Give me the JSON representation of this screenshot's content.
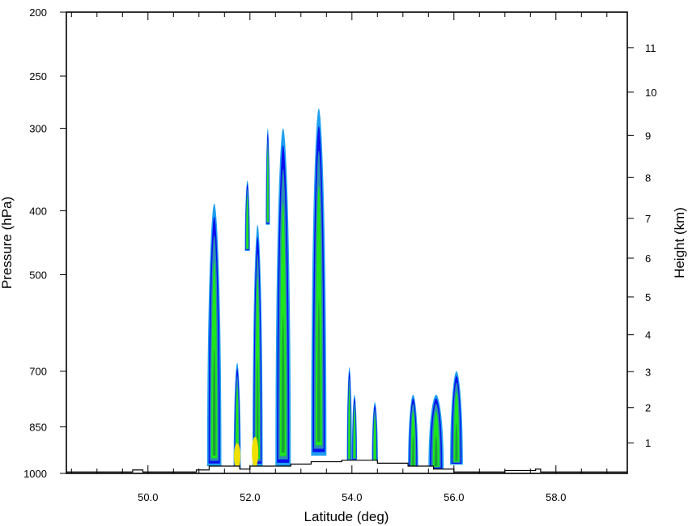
{
  "chart_data": {
    "type": "contour",
    "xlabel": "Latitude (deg)",
    "ylabel_left": "Pressure (hPa)",
    "ylabel_right": "Height (km)",
    "xlim": [
      48.4,
      59.4
    ],
    "x_ticks": [
      "50.0",
      "52.0",
      "54.0",
      "56.0",
      "58.0"
    ],
    "x_tick_values": [
      50,
      52,
      54,
      56,
      58
    ],
    "x_minor_step": 0.5,
    "ylim_pressure": [
      1000,
      200
    ],
    "y_scale": "log",
    "pressure_ticks": [
      "200",
      "250",
      "300",
      "400",
      "500",
      "700",
      "850",
      "1000"
    ],
    "pressure_tick_values": [
      200,
      250,
      300,
      400,
      500,
      700,
      850,
      1000
    ],
    "height_ticks": [
      "1",
      "2",
      "3",
      "4",
      "5",
      "6",
      "7",
      "8",
      "9",
      "10",
      "11"
    ],
    "height_tick_values": [
      1,
      2,
      3,
      4,
      5,
      6,
      7,
      8,
      9,
      10,
      11
    ],
    "colors": {
      "light_blue": "#1f9ff0",
      "blue": "#0a10f0",
      "teal": "#2a8fb0",
      "green": "#1ee61e",
      "dark_green": "#1aa23a",
      "yellow": "#f0e000",
      "outline": "#000000"
    },
    "columns": [
      {
        "lat": 51.3,
        "width": 0.28,
        "top_hPa": 390,
        "bottom_hPa": 975
      },
      {
        "lat": 51.75,
        "width": 0.14,
        "top_hPa": 680,
        "bottom_hPa": 985
      },
      {
        "lat": 51.95,
        "width": 0.1,
        "top_hPa": 360,
        "bottom_hPa": 460
      },
      {
        "lat": 52.15,
        "width": 0.2,
        "top_hPa": 420,
        "bottom_hPa": 975
      },
      {
        "lat": 52.35,
        "width": 0.08,
        "top_hPa": 300,
        "bottom_hPa": 420
      },
      {
        "lat": 52.65,
        "width": 0.3,
        "top_hPa": 300,
        "bottom_hPa": 975
      },
      {
        "lat": 53.35,
        "width": 0.3,
        "top_hPa": 280,
        "bottom_hPa": 940
      },
      {
        "lat": 53.95,
        "width": 0.1,
        "top_hPa": 690,
        "bottom_hPa": 960
      },
      {
        "lat": 54.05,
        "width": 0.1,
        "top_hPa": 760,
        "bottom_hPa": 955
      },
      {
        "lat": 54.45,
        "width": 0.12,
        "top_hPa": 780,
        "bottom_hPa": 970
      },
      {
        "lat": 55.2,
        "width": 0.2,
        "top_hPa": 760,
        "bottom_hPa": 985
      },
      {
        "lat": 55.65,
        "width": 0.3,
        "top_hPa": 760,
        "bottom_hPa": 985
      },
      {
        "lat": 56.05,
        "width": 0.25,
        "top_hPa": 700,
        "bottom_hPa": 970
      }
    ],
    "terrain_profile": [
      [
        48.4,
        995
      ],
      [
        49.7,
        995
      ],
      [
        49.7,
        988
      ],
      [
        49.9,
        988
      ],
      [
        49.9,
        995
      ],
      [
        50.95,
        995
      ],
      [
        50.95,
        988
      ],
      [
        51.2,
        988
      ],
      [
        51.2,
        975
      ],
      [
        51.8,
        975
      ],
      [
        51.8,
        985
      ],
      [
        52.0,
        985
      ],
      [
        52.0,
        975
      ],
      [
        52.8,
        975
      ],
      [
        52.8,
        968
      ],
      [
        53.2,
        968
      ],
      [
        53.2,
        960
      ],
      [
        53.8,
        960
      ],
      [
        53.8,
        955
      ],
      [
        54.5,
        955
      ],
      [
        54.5,
        965
      ],
      [
        55.1,
        965
      ],
      [
        55.1,
        975
      ],
      [
        55.6,
        975
      ],
      [
        55.6,
        985
      ],
      [
        56.0,
        985
      ],
      [
        56.0,
        995
      ],
      [
        57.0,
        995
      ],
      [
        57.0,
        990
      ],
      [
        57.6,
        990
      ],
      [
        57.6,
        985
      ],
      [
        57.7,
        985
      ],
      [
        57.7,
        995
      ],
      [
        59.4,
        995
      ]
    ]
  }
}
